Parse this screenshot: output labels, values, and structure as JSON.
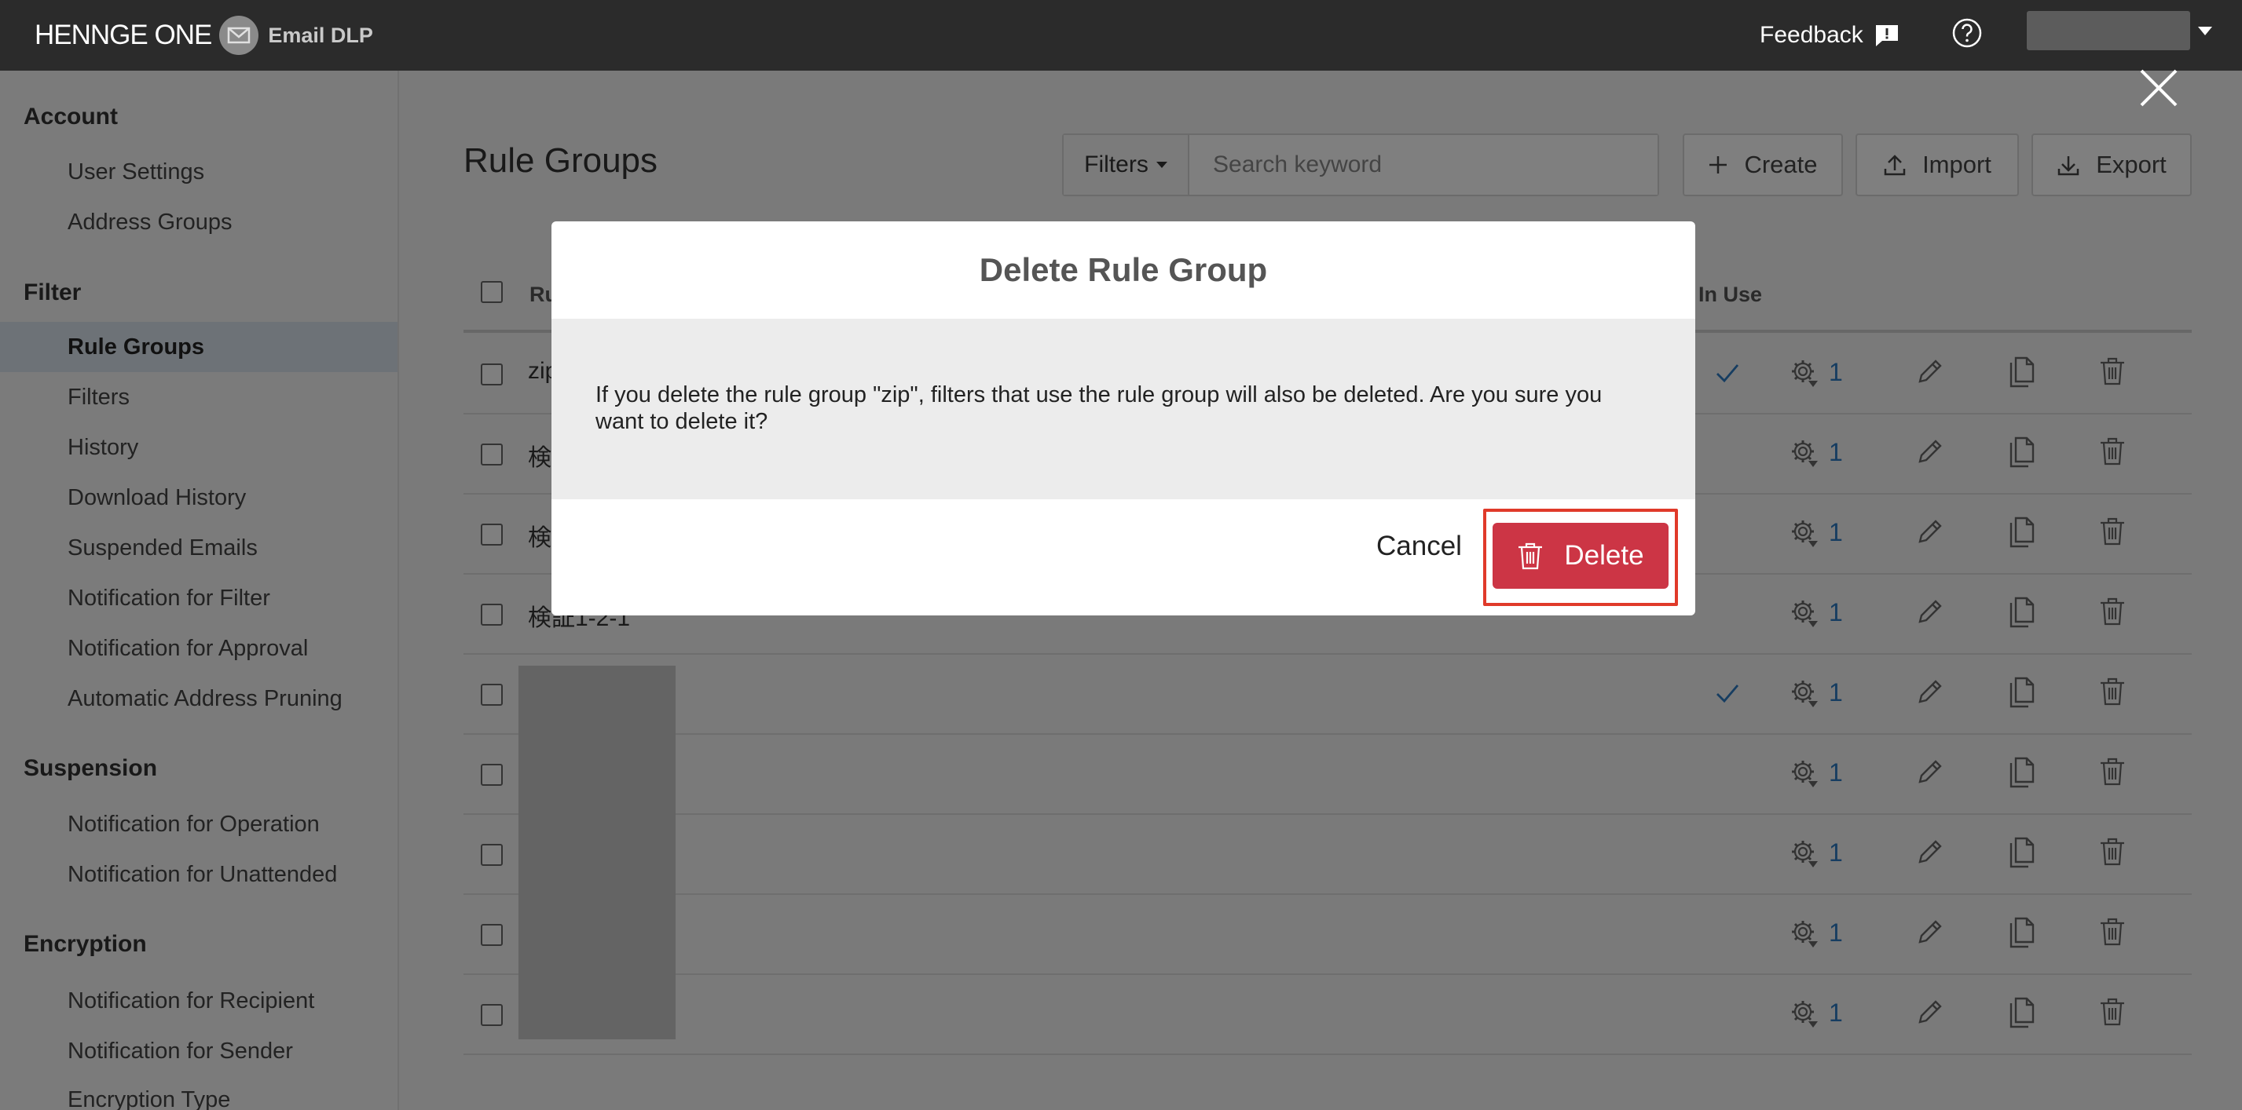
{
  "header": {
    "logo_main": "HENNGE",
    "logo_one": "ONE",
    "product": "Email DLP",
    "feedback_label": "Feedback"
  },
  "sidebar": {
    "sections": [
      {
        "title": "Account",
        "items": [
          "User Settings",
          "Address Groups"
        ]
      },
      {
        "title": "Filter",
        "items": [
          "Rule Groups",
          "Filters",
          "History",
          "Download History",
          "Suspended Emails",
          "Notification for Filter",
          "Notification for Approval",
          "Automatic Address Pruning"
        ]
      },
      {
        "title": "Suspension",
        "items": [
          "Notification for Operation",
          "Notification for Unattended"
        ]
      },
      {
        "title": "Encryption",
        "items": [
          "Notification for Recipient",
          "Notification for Sender",
          "Encryption Type"
        ]
      }
    ],
    "active_item": "Rule Groups"
  },
  "main": {
    "title": "Rule Groups",
    "filters_label": "Filters",
    "search_placeholder": "Search keyword",
    "create_label": "Create",
    "import_label": "Import",
    "export_label": "Export"
  },
  "table": {
    "headers": {
      "name": "Ru",
      "in_use": "In Use"
    },
    "rows": [
      {
        "name": "zip",
        "in_use": true,
        "count": "1"
      },
      {
        "name": "検",
        "in_use": false,
        "count": "1"
      },
      {
        "name": "検",
        "in_use": false,
        "count": "1"
      },
      {
        "name": "検証1-2-1",
        "in_use": false,
        "count": "1"
      },
      {
        "name": "",
        "in_use": true,
        "count": "1"
      },
      {
        "name": "",
        "in_use": false,
        "count": "1"
      },
      {
        "name": "",
        "in_use": false,
        "count": "1"
      },
      {
        "name": "",
        "in_use": false,
        "count": "1"
      },
      {
        "name": "",
        "in_use": false,
        "count": "1"
      }
    ]
  },
  "modal": {
    "title": "Delete Rule Group",
    "message": "If you delete the rule group \"zip\", filters that use the rule group will also be deleted. Are you sure you want to delete it?",
    "cancel_label": "Cancel",
    "delete_label": "Delete"
  },
  "colors": {
    "topbar": "#2b2b2b",
    "delete_button": "#cc3545",
    "highlight": "#e03a2a",
    "link": "#2d7ac2"
  }
}
